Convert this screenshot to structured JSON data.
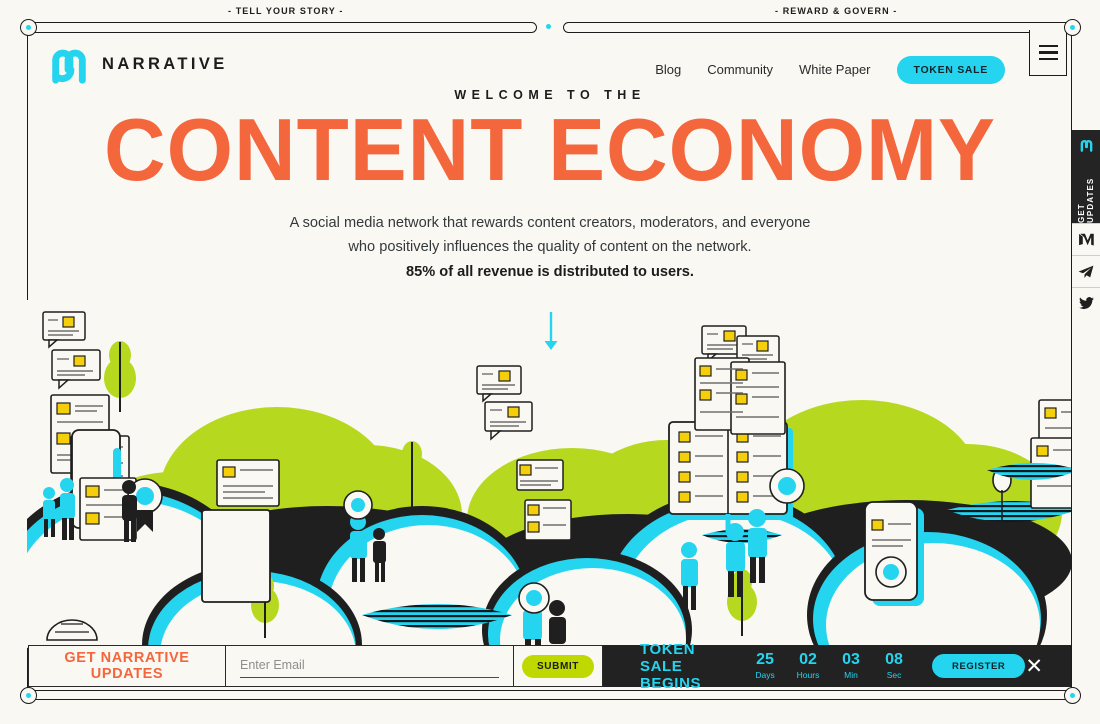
{
  "frame": {
    "label_left": "- TELL YOUR STORY -",
    "label_right": "- REWARD & GOVERN -"
  },
  "header": {
    "brand": "NARRATIVE",
    "logo_icon": "narrative-logo-icon",
    "menu_icon": "hamburger-menu-icon",
    "nav": [
      {
        "label": "Blog"
      },
      {
        "label": "Community"
      },
      {
        "label": "White Paper"
      }
    ],
    "cta_label": "TOKEN SALE"
  },
  "hero": {
    "eyebrow": "WELCOME TO THE",
    "headline": "CONTENT ECONOMY",
    "line1": "A social media network that rewards content creators, moderators, and everyone",
    "line2": "who positively influences the quality of content on the network.",
    "line3": "85% of all revenue is distributed to users.",
    "scroll_icon": "scroll-down-arrow-icon"
  },
  "signup": {
    "title": "GET NARRATIVE UPDATES",
    "email_value": "",
    "email_placeholder": "Enter Email",
    "submit_label": "SUBMIT"
  },
  "countdown": {
    "title": "TOKEN SALE BEGINS",
    "units": [
      {
        "value": "25",
        "label": "Days"
      },
      {
        "value": "02",
        "label": "Hours"
      },
      {
        "value": "03",
        "label": "Min"
      },
      {
        "value": "08",
        "label": "Sec"
      }
    ],
    "register_label": "REGISTER",
    "close_icon": "close-icon",
    "close_glyph": "✕"
  },
  "social_rail": {
    "updates_label": "GET UPDATES",
    "updates_icon": "narrative-logo-icon",
    "items": [
      {
        "name": "medium-icon"
      },
      {
        "name": "telegram-icon"
      },
      {
        "name": "twitter-icon"
      }
    ]
  },
  "colors": {
    "background": "#faf8f3",
    "accent_cyan": "#25d4ef",
    "accent_orange": "#f4663c",
    "accent_green": "#bfd900",
    "ink": "#1c1c1c",
    "dark_bar": "#222222",
    "hill_green": "#b6d91f",
    "paper_yellow": "#f5d00a"
  }
}
